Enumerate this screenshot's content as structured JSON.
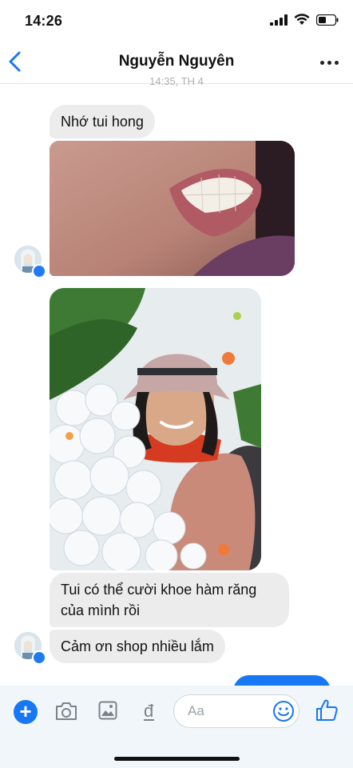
{
  "status_bar": {
    "time": "14:26"
  },
  "header": {
    "contact_name": "Nguyễn Nguyên",
    "timestamp": "14:35, TH 4"
  },
  "messages": {
    "m1": "Nhớ tui hong",
    "m2": "Tui có thể cười khoe hàm răng của mình rồi",
    "m3": "Cảm ơn shop nhiều lắm"
  },
  "composer": {
    "placeholder": "Aa"
  },
  "colors": {
    "accent": "#1877f2",
    "bubble_gray": "#ececec"
  },
  "icons": [
    "back-chevron-icon",
    "more-icon",
    "plus-icon",
    "camera-icon",
    "gallery-icon",
    "payment-icon",
    "emoji-icon",
    "like-icon"
  ]
}
